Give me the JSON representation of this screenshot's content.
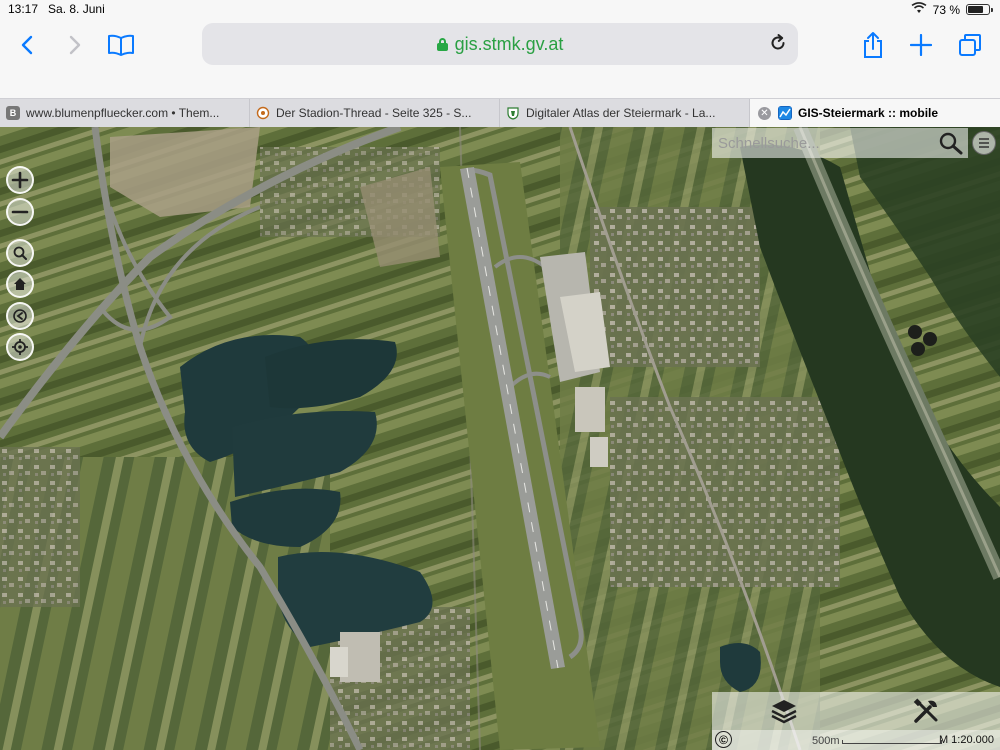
{
  "status": {
    "time": "13:17",
    "date": "Sa. 8. Juni",
    "battery": "73 %",
    "battery_level": 0.73
  },
  "browser": {
    "url": "gis.stmk.gv.at",
    "icons": [
      "back-icon",
      "forward-icon",
      "bookmarks-icon",
      "reload-icon",
      "share-icon",
      "new-tab-icon",
      "tabs-icon"
    ]
  },
  "tabs": [
    {
      "label": "www.blumenpfluecker.com • Them...",
      "favicon": "B"
    },
    {
      "label": "Der Stadion-Thread - Seite 325 - S...",
      "favicon": ""
    },
    {
      "label": "Digitaler Atlas der Steiermark - La...",
      "favicon": ""
    },
    {
      "label": "GIS-Steiermark :: mobile",
      "favicon": "",
      "active": true
    }
  ],
  "map": {
    "search_placeholder": "Schnellsuche...",
    "scale_label": "500m",
    "scale_ratio": "M 1:20.000",
    "copyright": "©",
    "controls": [
      "zoom-in-icon",
      "zoom-out-icon",
      "magnifier-icon",
      "home-icon",
      "back-extent-icon",
      "locate-icon"
    ],
    "colors": {
      "water": "#1f3a3c",
      "fields_dark": "#3d4e24",
      "fields_light": "#7d8a55",
      "forest": "#253820",
      "runway": "#9a9c98"
    }
  }
}
